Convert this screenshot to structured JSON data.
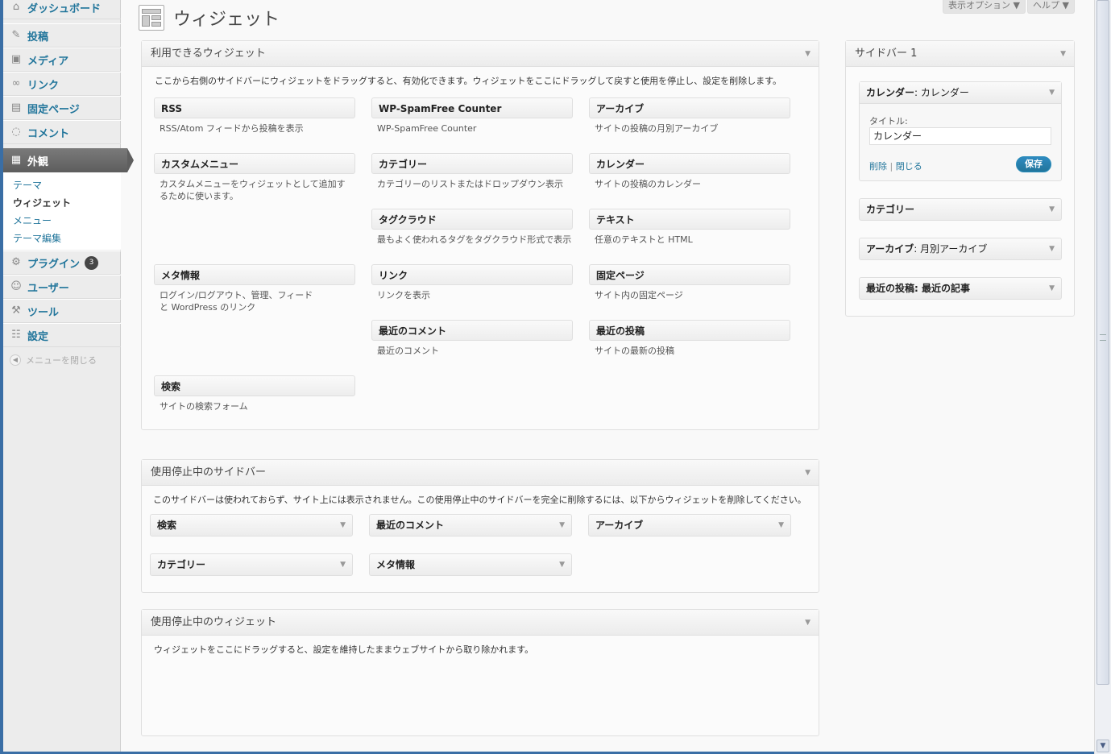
{
  "page": {
    "title": "ウィジェット"
  },
  "header": {
    "screen_options": "表示オプション ▼",
    "help": "ヘルプ ▼"
  },
  "sidebar": {
    "dashboard": "ダッシュボード",
    "posts": "投稿",
    "media": "メディア",
    "links": "リンク",
    "pages": "固定ページ",
    "comments": "コメント",
    "appearance": "外観",
    "appearance_sub": [
      "テーマ",
      "ウィジェット",
      "メニュー",
      "テーマ編集"
    ],
    "plugins": "プラグイン",
    "plugins_badge": "3",
    "users": "ユーザー",
    "tools": "ツール",
    "settings": "設定",
    "collapse": "メニューを閉じる"
  },
  "available": {
    "title": "利用できるウィジェット",
    "description": "ここから右側のサイドバーにウィジェットをドラッグすると、有効化できます。ウィジェットをここにドラッグして戻すと使用を停止し、設定を削除します。",
    "widgets": [
      {
        "name": "RSS",
        "desc": "RSS/Atom フィードから投稿を表示"
      },
      {
        "name": "WP-SpamFree Counter",
        "desc": "WP-SpamFree Counter"
      },
      {
        "name": "アーカイブ",
        "desc": "サイトの投稿の月別アーカイブ"
      },
      {
        "name": "カスタムメニュー",
        "desc": "カスタムメニューをウィジェットとして追加するために使います。"
      },
      {
        "name": "カテゴリー",
        "desc": "カテゴリーのリストまたはドロップダウン表示"
      },
      {
        "name": "カレンダー",
        "desc": "サイトの投稿のカレンダー"
      },
      {
        "name": "タグクラウド",
        "desc": "最もよく使われるタグをタグクラウド形式で表示"
      },
      {
        "name": "テキスト",
        "desc": "任意のテキストと HTML"
      },
      {
        "name": "メタ情報",
        "desc": "ログイン/ログアウト、管理、フィードと WordPress のリンク"
      },
      {
        "name": "リンク",
        "desc": "リンクを表示"
      },
      {
        "name": "固定ページ",
        "desc": "サイト内の固定ページ"
      },
      {
        "name": "最近のコメント",
        "desc": "最近のコメント"
      },
      {
        "name": "最近の投稿",
        "desc": "サイトの最新の投稿"
      },
      {
        "name": "検索",
        "desc": "サイトの検索フォーム"
      }
    ]
  },
  "inactive_sidebar": {
    "title": "使用停止中のサイドバー",
    "description": "このサイドバーは使われておらず、サイト上には表示されません。この使用停止中のサイドバーを完全に削除するには、以下からウィジェットを削除してください。",
    "widgets": [
      "検索",
      "最近のコメント",
      "アーカイブ",
      "カテゴリー",
      "メタ情報"
    ]
  },
  "inactive_widgets": {
    "title": "使用停止中のウィジェット",
    "description": "ウィジェットをここにドラッグすると、設定を維持したままウェブサイトから取り除かれます。"
  },
  "sidebar1": {
    "title": "サイドバー 1",
    "open_widget": {
      "name": "カレンダー",
      "instance": ": カレンダー",
      "title_label": "タイトル:",
      "title_value": "カレンダー",
      "delete": "削除",
      "separator": "|",
      "close": "閉じる",
      "save": "保存"
    },
    "widgets": [
      {
        "name": "カテゴリー",
        "instance": ""
      },
      {
        "name": "アーカイブ",
        "instance": ": 月別アーカイブ"
      },
      {
        "name": "最近の投稿",
        "instance": ": 最近の記事"
      }
    ]
  },
  "ui": {
    "caret": "▼",
    "scroll_down": "▼"
  }
}
